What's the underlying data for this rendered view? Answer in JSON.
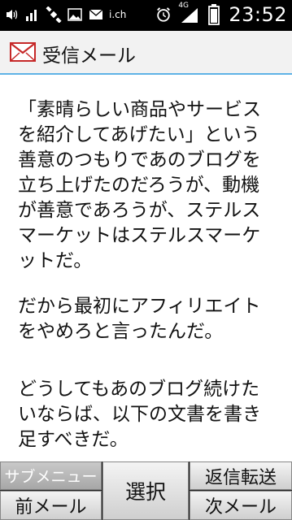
{
  "statusbar": {
    "icons": [
      "ring-volume-icon",
      "signal-strength-icon",
      "satellite-icon",
      "image-icon",
      "mail-icon",
      "ich-icon",
      "alarm-icon",
      "4g-signal-icon",
      "battery-icon"
    ],
    "ich_text": "i.ch",
    "network_text": "4G",
    "clock": "23:52"
  },
  "titlebar": {
    "title": "受信メール",
    "icon": "mail-envelope-icon"
  },
  "message": {
    "paragraph1": "「素晴らしい商品やサービス\nを紹介してあげたい」という\n善意のつもりであのブログを\n立ち上げたのだろうが、動機\nが善意であろうが、ステルス\nマーケットはステルスマーケ\nットだ。",
    "paragraph2": "だから最初にアフィリエイト\nをやめろと言ったんだ。",
    "paragraph3": "どうしてもあのブログ続けた\nいならば、以下の文書を書き\n足すべきだ。"
  },
  "softkeys": {
    "submenu": "サブメニュー",
    "prev_mail": "前メール",
    "select": "選択",
    "reply_forward": "返信転送",
    "next_mail": "次メール"
  },
  "colors": {
    "status_bg": "#000000",
    "titlebar_bg": "#f2f2f2",
    "accent_line": "#5fb3e6",
    "softkey_bg": "#dcdcdc"
  }
}
